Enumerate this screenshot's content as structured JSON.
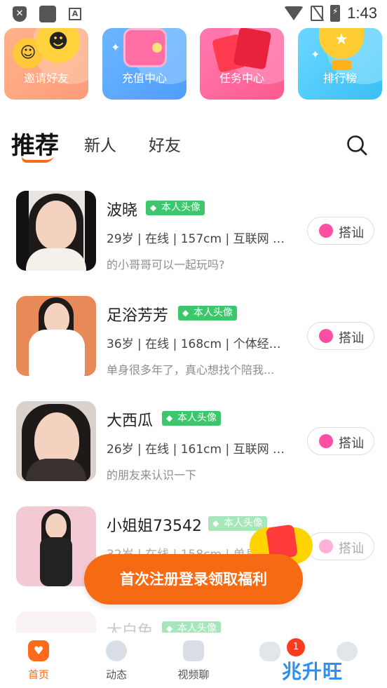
{
  "status_bar": {
    "time": "1:43",
    "shield_glyph": "✕",
    "a_glyph": "A"
  },
  "feature_cards": [
    {
      "label": "邀请好友",
      "icon": "smile-emoji-icon"
    },
    {
      "label": "充值中心",
      "icon": "wallet-icon"
    },
    {
      "label": "任务中心",
      "icon": "red-envelope-icon"
    },
    {
      "label": "排行榜",
      "icon": "trophy-icon"
    }
  ],
  "tabs": {
    "active": "推荐",
    "items": [
      "新人",
      "好友"
    ]
  },
  "users": [
    {
      "name": "波晓",
      "badge": "本人头像",
      "info": "29岁 | 在线 | 157cm | 互联网 | ...",
      "bio": "的小哥哥可以一起玩吗?",
      "chat": "搭讪"
    },
    {
      "name": "足浴芳芳",
      "badge": "本人头像",
      "info": "36岁 | 在线 | 168cm | 个体经营...",
      "bio": "单身很多年了，真心想找个陪我...",
      "chat": "搭讪"
    },
    {
      "name": "大西瓜",
      "badge": "本人头像",
      "info": "26岁 | 在线 | 161cm | 互联网 | ...",
      "bio": "的朋友来认识一下",
      "chat": "搭讪"
    },
    {
      "name": "小姐姐73542",
      "badge": "本人头像",
      "info": "32岁 | 在线 | 158cm | 单身",
      "bio": "",
      "chat": "搭讪"
    },
    {
      "name": "大白兔",
      "badge": "本人头像",
      "info": "",
      "bio": "",
      "chat": ""
    }
  ],
  "register_banner": "首次注册登录领取福利",
  "bottom_nav": {
    "home": "首页",
    "feed": "动态",
    "video": "视频聊",
    "messages_badge": "1"
  },
  "watermark": "兆升旺",
  "colors": {
    "accent": "#f56a12",
    "verified": "#3ec66a",
    "heart": "#ff4fa4"
  }
}
